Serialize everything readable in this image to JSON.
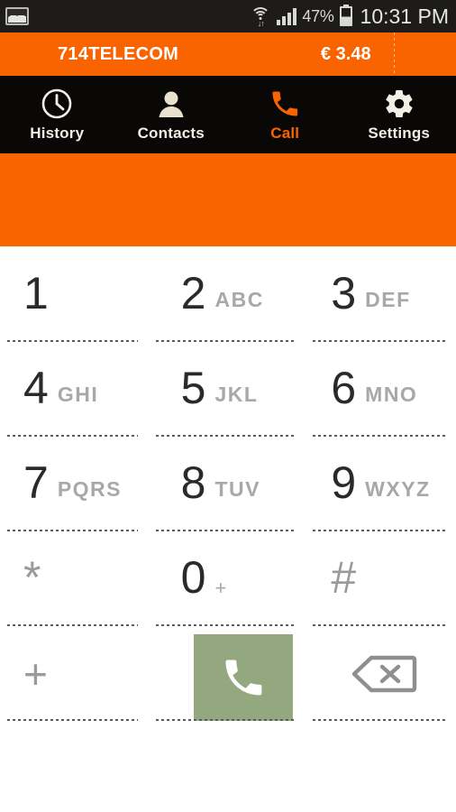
{
  "status_bar": {
    "notification_icon": "gallery-icon",
    "wifi_icon": "wifi-icon",
    "signal_icon": "cellular-signal-icon",
    "battery_percent": "47%",
    "battery_icon": "battery-icon",
    "time": "10:31 PM"
  },
  "account": {
    "name": "714TELECOM",
    "balance": "€ 3.48"
  },
  "tabs": [
    {
      "label": "History",
      "icon": "clock-icon",
      "active": false
    },
    {
      "label": "Contacts",
      "icon": "person-icon",
      "active": false
    },
    {
      "label": "Call",
      "icon": "phone-icon",
      "active": true
    },
    {
      "label": "Settings",
      "icon": "gear-icon",
      "active": false
    }
  ],
  "number_display": {
    "value": "",
    "placeholder": ""
  },
  "keypad": {
    "rows": [
      [
        {
          "digit": "1",
          "letters": ""
        },
        {
          "digit": "2",
          "letters": "ABC"
        },
        {
          "digit": "3",
          "letters": "DEF"
        }
      ],
      [
        {
          "digit": "4",
          "letters": "GHI"
        },
        {
          "digit": "5",
          "letters": "JKL"
        },
        {
          "digit": "6",
          "letters": "MNO"
        }
      ],
      [
        {
          "digit": "7",
          "letters": "PQRS"
        },
        {
          "digit": "8",
          "letters": "TUV"
        },
        {
          "digit": "9",
          "letters": "WXYZ"
        }
      ],
      [
        {
          "digit": "*",
          "letters": ""
        },
        {
          "digit": "0",
          "letters": "+"
        },
        {
          "digit": "#",
          "letters": ""
        }
      ]
    ],
    "action_row": {
      "plus_label": "+",
      "call_icon": "phone-icon",
      "backspace_icon": "backspace-icon"
    }
  },
  "colors": {
    "brand_orange": "#f96400",
    "status_bar": "#1d1c1b",
    "tab_bar": "#0a0806",
    "call_green": "#93a87e",
    "key_digit": "#2a2a2a",
    "key_letters": "#a8a8a8"
  }
}
